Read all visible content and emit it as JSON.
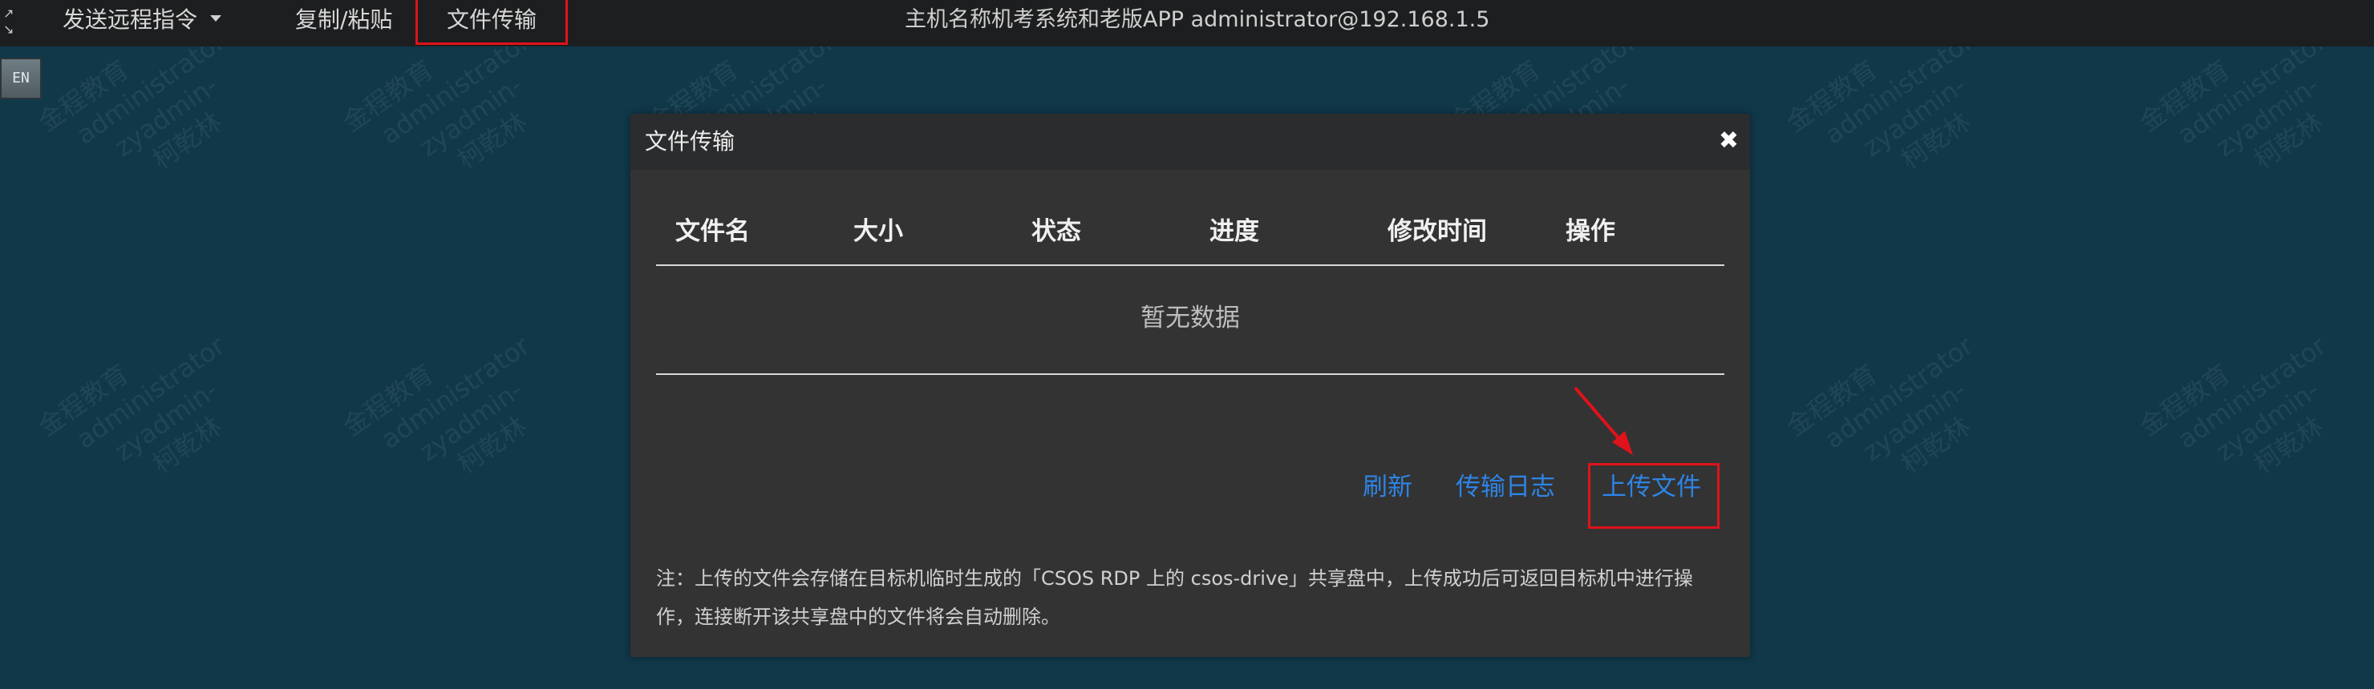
{
  "topbar": {
    "send_command": "发送远程指令",
    "copy_paste": "复制/粘贴",
    "file_transfer": "文件传输",
    "window_title": "主机名称机考系统和老版APP administrator@192.168.1.5",
    "fullscreen_icon": "fullscreen-icon",
    "lang_badge": "EN"
  },
  "watermark": {
    "lines": [
      "金程教育",
      "administrator",
      "zyadmin-",
      "柯乾林"
    ]
  },
  "modal": {
    "title": "文件传输",
    "close_icon": "close-icon",
    "close_glyph": "✖",
    "columns": [
      "文件名",
      "大小",
      "状态",
      "进度",
      "修改时间",
      "操作"
    ],
    "empty_text": "暂无数据",
    "actions": {
      "refresh": "刷新",
      "transfer_log": "传输日志",
      "upload": "上传文件"
    },
    "note_line1": "注：上传的文件会存储在目标机临时生成的「CSOS RDP 上的 csos-drive」共享盘中，上传成功后可返回目标机中进行操",
    "note_line2": "作，连接断开该共享盘中的文件将会自动删除。"
  },
  "colors": {
    "background": "#103849",
    "topbar": "#1d1e1f",
    "modal": "#333333",
    "link": "#2d84e5",
    "highlight": "#e0121b"
  }
}
